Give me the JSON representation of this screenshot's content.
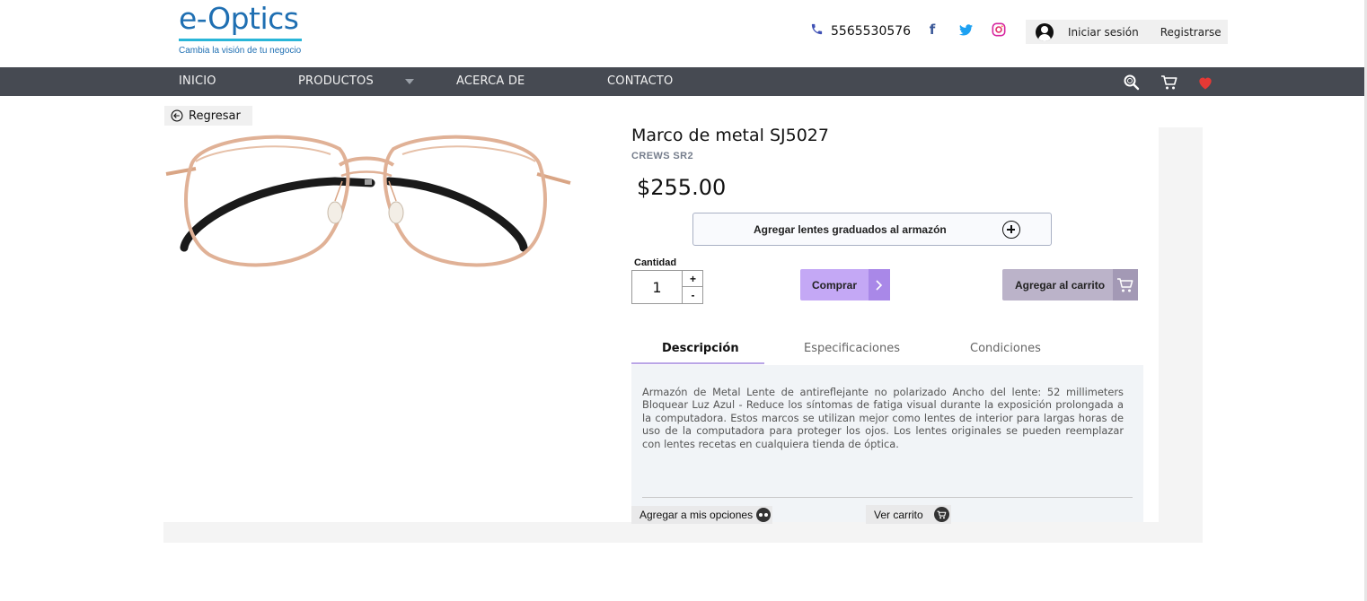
{
  "header": {
    "logo_text": "e-Optics",
    "logo_tagline": "Cambia la visión de tu negocio",
    "phone": "5565530576",
    "login_label": "Iniciar sesión",
    "register_label": "Registrarse",
    "social_icons": [
      "facebook-icon",
      "twitter-icon",
      "instagram-icon"
    ]
  },
  "nav": {
    "items": [
      "INICIO",
      "PRODUCTOS",
      "ACERCA DE",
      "CONTACTO"
    ],
    "icons": [
      "search-icon",
      "cart-icon",
      "heart-icon"
    ],
    "heart_color": "#e53935"
  },
  "back_label": "Regresar",
  "product": {
    "title": "Marco de metal SJ5027",
    "brand": "CREWS SR2",
    "price": "$255.00",
    "lens_button": "Agregar lentes graduados al armazón",
    "quantity_label": "Cantidad",
    "quantity": "1",
    "qty_plus": "+",
    "qty_minus": "-",
    "buy_label": "Comprar",
    "add_to_cart_label": "Agregar al carrito"
  },
  "tabs": [
    {
      "label": "Descripción",
      "active": true
    },
    {
      "label": "Especificaciones",
      "active": false
    },
    {
      "label": "Condiciones",
      "active": false
    }
  ],
  "description": "Armazón de Metal Lente de antireflejante no polarizado Ancho del lente: 52 millimeters Bloquear Luz Azul - Reduce los síntomas de fatiga visual durante la exposición prolongada a la computadora. Estos marcos se utilizan mejor como lentes de interior para largas horas de uso de la computadora para proteger los ojos. Los lentes originales se pueden reemplazar con lentes recetas en cualquiera tienda de óptica.",
  "footer_actions": {
    "options_label": "Agregar a mis opciones",
    "view_cart_label": "Ver carrito"
  },
  "colors": {
    "nav_bg": "#464a52",
    "buy_button": "#c4a8f5",
    "cart_button": "#bbb3c9",
    "logo_blue": "#1f6fb2",
    "logo_line": "#29b6d8"
  }
}
